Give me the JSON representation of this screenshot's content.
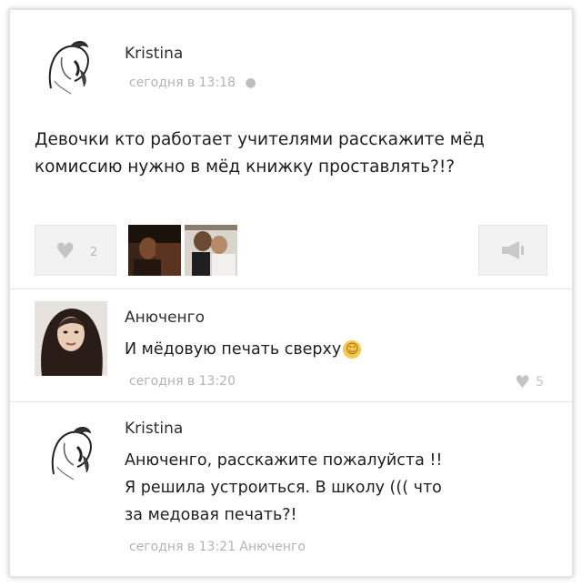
{
  "post": {
    "author": "Kristina",
    "time": "сегодня в 13:18",
    "device_icon": "apple-icon",
    "text": "Девочки кто работает учителями расскажите мёд комиссию нужно в мёд книжку проставлять?!?",
    "likes": "2",
    "like_icon": "heart-icon",
    "share_icon": "megaphone-icon"
  },
  "comments": [
    {
      "author": "Анюченго",
      "text": "И мёдовую печать сверху",
      "emoji": "☺",
      "time": "сегодня в 13:20",
      "likes": "5"
    },
    {
      "author": "Kristina",
      "text_lines": [
        "Анюченго, расскажите пожалуйста !!",
        "Я решила устроиться. В школу ((( что",
        "за медовая печать?!"
      ],
      "time": "сегодня в 13:21 Анюченго"
    }
  ],
  "colors": {
    "muted": "#b3b3b3",
    "text": "#1e1e1e",
    "button_bg": "#f2f2f2"
  }
}
